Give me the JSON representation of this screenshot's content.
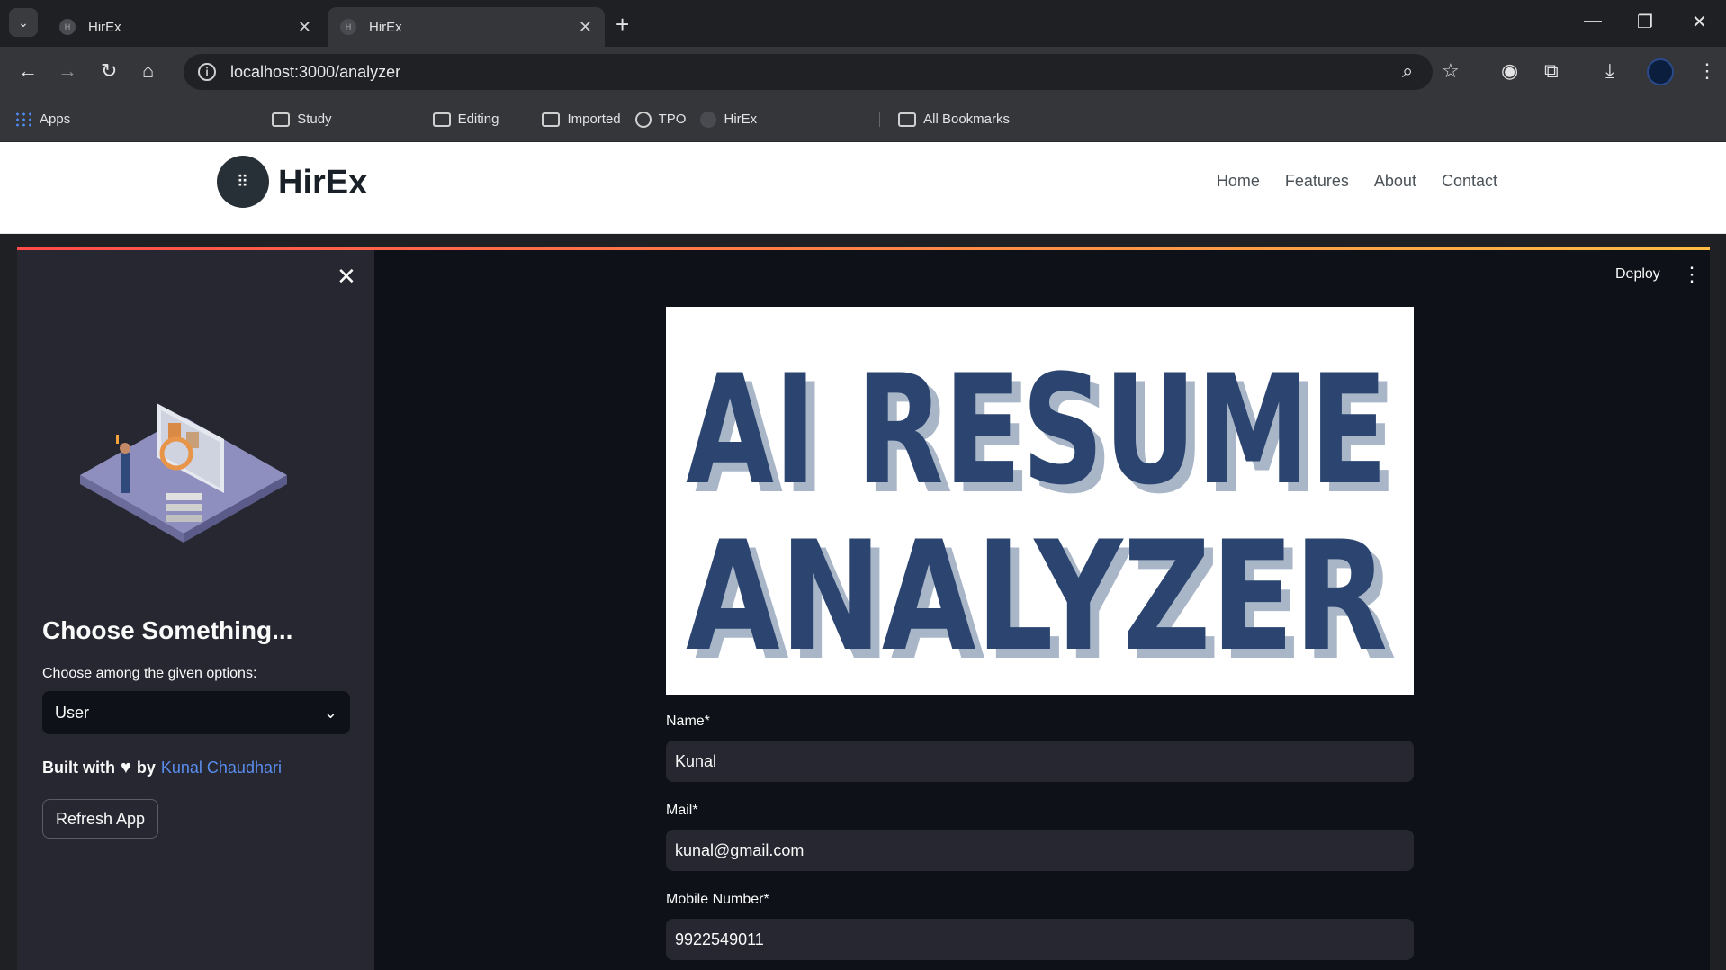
{
  "browser": {
    "tabs": [
      {
        "title": "HirEx",
        "favicon": "H"
      },
      {
        "title": "HirEx",
        "favicon": "H"
      }
    ],
    "url": "localhost:3000/analyzer",
    "bookmarks": [
      {
        "label": "Apps",
        "icon": "apps-grid-icon"
      },
      {
        "label": "Study",
        "icon": "folder-icon"
      },
      {
        "label": "Editing",
        "icon": "folder-icon"
      },
      {
        "label": "Imported",
        "icon": "folder-icon"
      },
      {
        "label": "TPO",
        "icon": "globe-icon"
      },
      {
        "label": "HirEx",
        "icon": "hirex-favicon"
      }
    ],
    "all_bookmarks_label": "All Bookmarks"
  },
  "site": {
    "logo_text": "HirEx",
    "nav": [
      "Home",
      "Features",
      "About",
      "Contact"
    ]
  },
  "sidebar": {
    "title": "Choose Something...",
    "select_label": "Choose among the given options:",
    "select_value": "User",
    "built_with": "Built with",
    "by": "by",
    "author": "Kunal Chaudhari",
    "refresh_label": "Refresh App"
  },
  "app": {
    "deploy_label": "Deploy",
    "banner_line1": "AI RESUME",
    "banner_line2": "ANALYZER",
    "fields": [
      {
        "label": "Name*",
        "value": "Kunal"
      },
      {
        "label": "Mail*",
        "value": "kunal@gmail.com"
      },
      {
        "label": "Mobile Number*",
        "value": "9922549011"
      }
    ]
  },
  "colors": {
    "accent_red": "#ff4b4b",
    "link_blue": "#5a8dee",
    "banner_navy": "#2b4570",
    "banner_shadow": "#a9b6c8"
  }
}
